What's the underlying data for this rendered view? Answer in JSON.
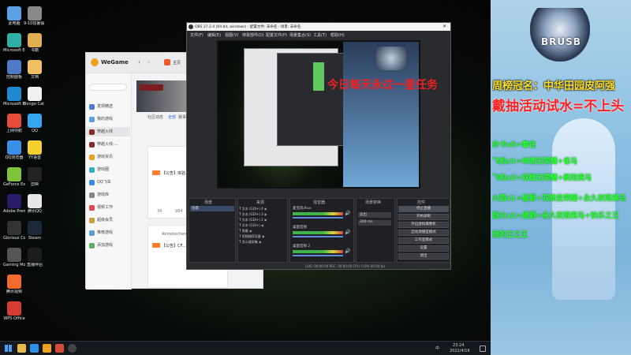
{
  "desktop_icons": [
    {
      "label": "此电脑",
      "color": "#5aa0e6"
    },
    {
      "label": "Microsoft Edge",
      "color": "#2fb0a5"
    },
    {
      "label": "控制面板",
      "color": "#4d79c7"
    },
    {
      "label": "Microsoft Edge",
      "color": "#1e88d0"
    },
    {
      "label": "上网导航",
      "color": "#e64a3a"
    },
    {
      "label": "QQ浏览器",
      "color": "#3a8ee6"
    },
    {
      "label": "GeForce Experience",
      "color": "#7fc33c"
    },
    {
      "label": "Adobe Premie...",
      "color": "#2b1a66"
    },
    {
      "label": "Glorious Core",
      "color": "#333"
    },
    {
      "label": "Gaming Mouse",
      "color": "#555"
    },
    {
      "label": "腾讯视频",
      "color": "#f26b2c"
    },
    {
      "label": "WPS Office",
      "color": "#d43c33"
    },
    {
      "label": "9-10班暑假 练习(4)2.0...",
      "color": "#888"
    },
    {
      "label": "书籍",
      "color": "#e0b050"
    },
    {
      "label": "文档",
      "color": "#f0c060"
    },
    {
      "label": "Bongo Cat Mver",
      "color": "#f0f0f0"
    },
    {
      "label": "QQ",
      "color": "#36a6f0"
    },
    {
      "label": "YY语音",
      "color": "#f5d02e"
    },
    {
      "label": "剪映",
      "color": "#222"
    },
    {
      "label": "腾讯QQ",
      "color": "#e7e7e7"
    },
    {
      "label": "Steam",
      "color": "#1b2838"
    },
    {
      "label": "直播伴侣",
      "color": "#1c1c1c"
    }
  ],
  "taskbar": {
    "time": "23:24",
    "date": "2022/4/16",
    "lang": "中"
  },
  "wegame": {
    "brand": "WeGame",
    "tab": "主页",
    "sidebar": [
      "发现精选",
      "我的游戏",
      "穿越火线",
      "穿越火线-...",
      "游戏资讯",
      "游戏圈",
      "QQ飞车",
      "游戏库",
      "视频工作",
      "超级会员",
      "推荐游戏",
      "添加游戏"
    ],
    "tabs": [
      "社区动态",
      "全部",
      "赛事"
    ],
    "post1_title": "【公告】体验...",
    "post2_author": "Akmotochen",
    "post2_title": "【公告】CF...",
    "stats": [
      "34",
      "984"
    ]
  },
  "obs": {
    "title": "OBS 27.2.4 (64 bit, windows) - 配置文件: 未命名 - 场景: 未命名",
    "menu": [
      "文件(F)",
      "编辑(E)",
      "视图(V)",
      "停靠部件(D)",
      "配置文件(P)",
      "场景集合(S)",
      "工具(T)",
      "帮助(H)"
    ],
    "docks": [
      "场景",
      "来源",
      "混音器",
      "场景转换",
      "控件"
    ],
    "scene": "场景",
    "sources": [
      "文本 (GDI+) 4",
      "文本 (GDI+) 3",
      "文本 (GDI+) 2",
      "文本 (GDI+)",
      "图像",
      "视频捕获设备",
      "显示器采集"
    ],
    "mixer": [
      "麦克风/Aux",
      "桌面音频",
      "桌面音频 2"
    ],
    "transition": "淡出",
    "duration": "300 ms",
    "controls": [
      "停止直播",
      "开始录制",
      "开启虚拟摄像机",
      "启动演播室模式",
      "工作室模式",
      "设置",
      "退出"
    ],
    "status": "LIVE: 00:00:00  REC: 00:00:00  CPU: 0.0%  60.00 fps",
    "overlay_text": "今日每天永过一星任务"
  },
  "stream_overlay": {
    "logo_text": "BRUSB",
    "lines": [
      "周榜冠名：中华田园皮阿强",
      "戴抽活动试水=不上头",
      "办卡x5=着往",
      "飞机x1=单鼎无荣耀+雀马",
      "飞机x2=双雌无荣耀+枫阳黄马",
      "火箭x1=星爵+双鼎变荣耀+永久权限黄马",
      "超火x1=星爵+永久权限黄马+快乐之王",
      "我的王之王"
    ]
  }
}
